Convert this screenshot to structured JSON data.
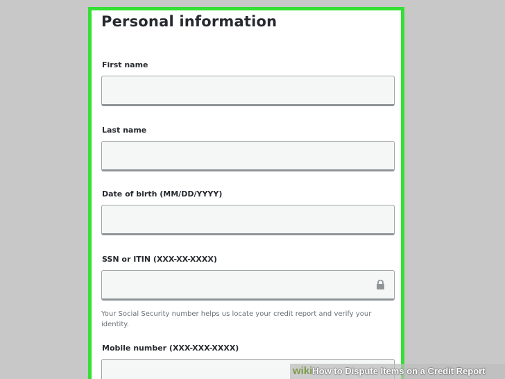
{
  "form": {
    "title": "Personal information",
    "fields": [
      {
        "label": "First name",
        "value": ""
      },
      {
        "label": "Last name",
        "value": ""
      },
      {
        "label": "Date of birth (MM/DD/YYYY)",
        "value": ""
      },
      {
        "label": "SSN or ITIN (XXX-XX-XXXX)",
        "value": ""
      },
      {
        "label": "Mobile number (XXX-XXX-XXXX)",
        "value": ""
      }
    ],
    "ssn_help": "Your Social Security number helps us locate your credit report and verify your identity.",
    "ssn_icon": "lock-icon"
  },
  "colors": {
    "highlight_border": "#33e033",
    "background": "#c8c8c8",
    "text": "#26292e"
  },
  "watermark": {
    "brand": "wiki",
    "how": "How",
    "title": " to Dispute Items on a Credit Report"
  }
}
